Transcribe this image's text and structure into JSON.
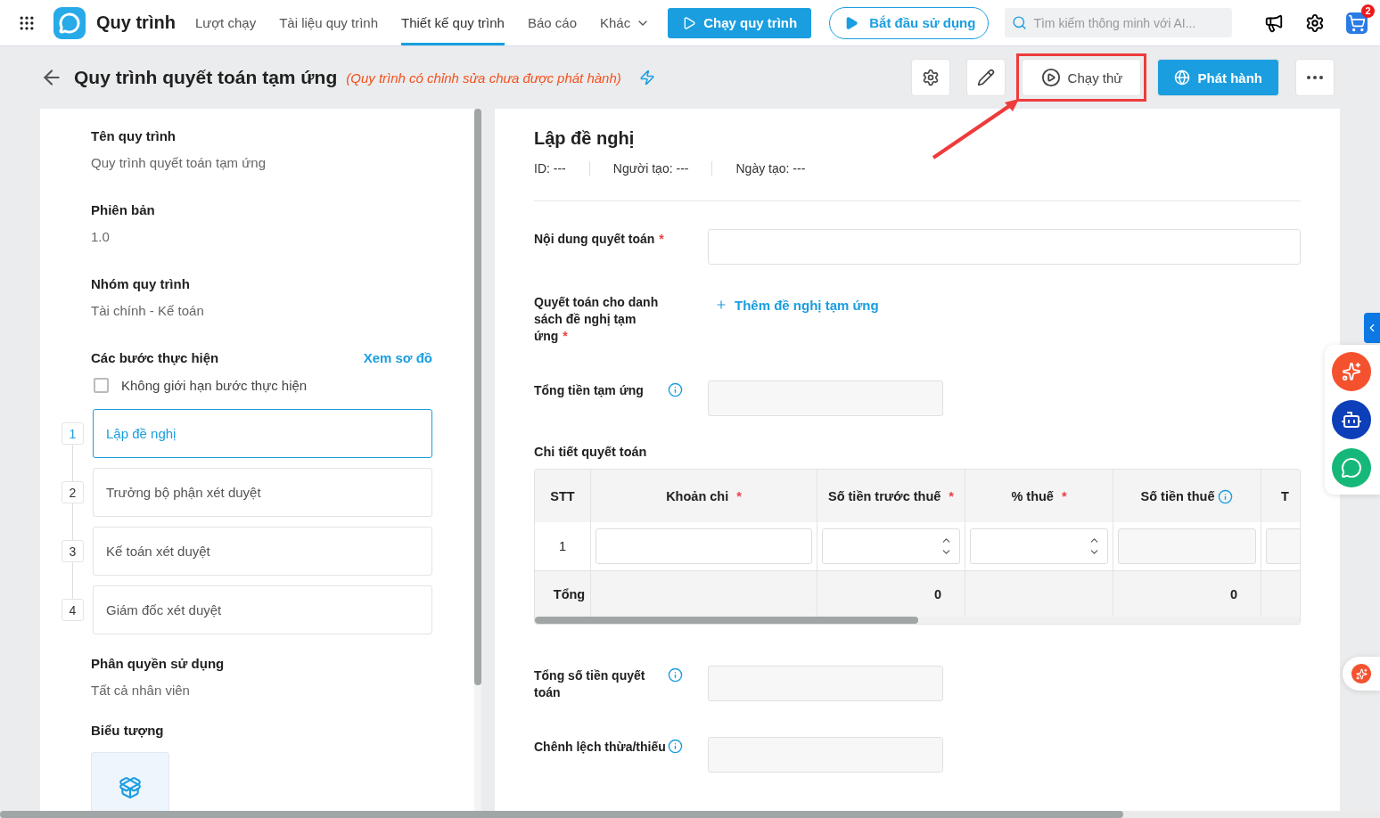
{
  "required_mark": "*",
  "topbar": {
    "app_name": "Quy trình",
    "nav": [
      {
        "label": "Lượt chạy",
        "selected": false
      },
      {
        "label": "Tài liệu quy trình",
        "selected": false
      },
      {
        "label": "Thiết kế quy trình",
        "selected": true
      },
      {
        "label": "Báo cáo",
        "selected": false
      }
    ],
    "more": "Khác",
    "run_button": "Chạy quy trình",
    "start_button": "Bắt đầu sử dụng",
    "search": {
      "placeholder": "Tìm kiếm thông minh với AI..."
    },
    "cart_badge": "2"
  },
  "header": {
    "title": "Quy trình quyết toán tạm ứng",
    "note": "(Quy trình có chỉnh sửa chưa được phát hành)",
    "actions": [
      {
        "kind": "settings",
        "highlighted": false
      },
      {
        "kind": "edit",
        "highlighted": false
      },
      {
        "kind": "test-run",
        "label": "Chạy thử",
        "highlighted": true
      },
      {
        "kind": "publish",
        "label": "Phát hành",
        "highlighted": false
      },
      {
        "kind": "more",
        "highlighted": false
      }
    ]
  },
  "sidebar": {
    "fields": [
      {
        "label": "Tên quy trình",
        "value": "Quy trình quyết toán tạm ứng"
      },
      {
        "label": "Phiên bản",
        "value": "1.0"
      },
      {
        "label": "Nhóm quy trình",
        "value": "Tài chính - Kế toán"
      }
    ],
    "steps_section": {
      "label": "Các bước thực hiện",
      "link": "Xem sơ đồ",
      "unlimited": {
        "label": "Không giới hạn bước thực hiện",
        "checked": false
      },
      "steps": [
        {
          "number": "1",
          "name": "Lập đề nghị",
          "selected": true
        },
        {
          "number": "2",
          "name": "Trưởng bộ phận xét duyệt",
          "selected": false
        },
        {
          "number": "3",
          "name": "Kế toán xét duyệt",
          "selected": false
        },
        {
          "number": "4",
          "name": "Giám đốc xét duyệt",
          "selected": false
        }
      ]
    },
    "permission": {
      "label": "Phân quyền sử dụng",
      "value": "Tất cả nhân viên"
    },
    "icon_label": "Biểu tượng"
  },
  "form": {
    "title": "Lập đề nghị",
    "meta": [
      {
        "label": "ID:",
        "value": "---"
      },
      {
        "label": "Người tạo:",
        "value": "---"
      },
      {
        "label": "Ngày tạo:",
        "value": "---"
      }
    ],
    "fields_before": [
      {
        "kind": "input",
        "label": "Nội dung quyết toán",
        "required": true,
        "info": false
      },
      {
        "kind": "link",
        "label": "Quyết toán cho danh sách đề nghị tạm ứng",
        "required": true,
        "info": false,
        "link": "Thêm đề nghị tạm ứng"
      },
      {
        "kind": "readonly",
        "label": "Tổng tiền tạm ứng",
        "required": false,
        "info": true
      }
    ],
    "detail": {
      "label": "Chi tiết quyết toán",
      "columns": [
        {
          "label": "STT",
          "required": false,
          "info": false
        },
        {
          "label": "Khoản chi",
          "required": true,
          "info": false
        },
        {
          "label": "Số tiền trước thuế",
          "required": true,
          "info": false
        },
        {
          "label": "% thuế",
          "required": true,
          "info": false
        },
        {
          "label": "Số tiền thuế",
          "required": false,
          "info": true
        },
        {
          "label": "T",
          "required": false,
          "info": false
        }
      ],
      "rows": [
        {
          "number": "1",
          "cells": [
            {
              "kind": "text"
            },
            {
              "kind": "number"
            },
            {
              "kind": "number"
            },
            {
              "kind": "readonly"
            },
            {
              "kind": "readonly"
            }
          ]
        }
      ],
      "total": {
        "label": "Tổng",
        "cells": [
          {
            "kind": "blank"
          },
          {
            "kind": "amount",
            "value": "0"
          },
          {
            "kind": "blank"
          },
          {
            "kind": "amount",
            "value": "0"
          },
          {
            "kind": "blank"
          }
        ]
      }
    },
    "fields_after": [
      {
        "kind": "readonly",
        "label": "Tổng số tiền quyết toán",
        "required": false,
        "info": true
      },
      {
        "kind": "readonly",
        "label": "Chênh lệch thừa/thiếu",
        "required": false,
        "info": true
      }
    ]
  }
}
